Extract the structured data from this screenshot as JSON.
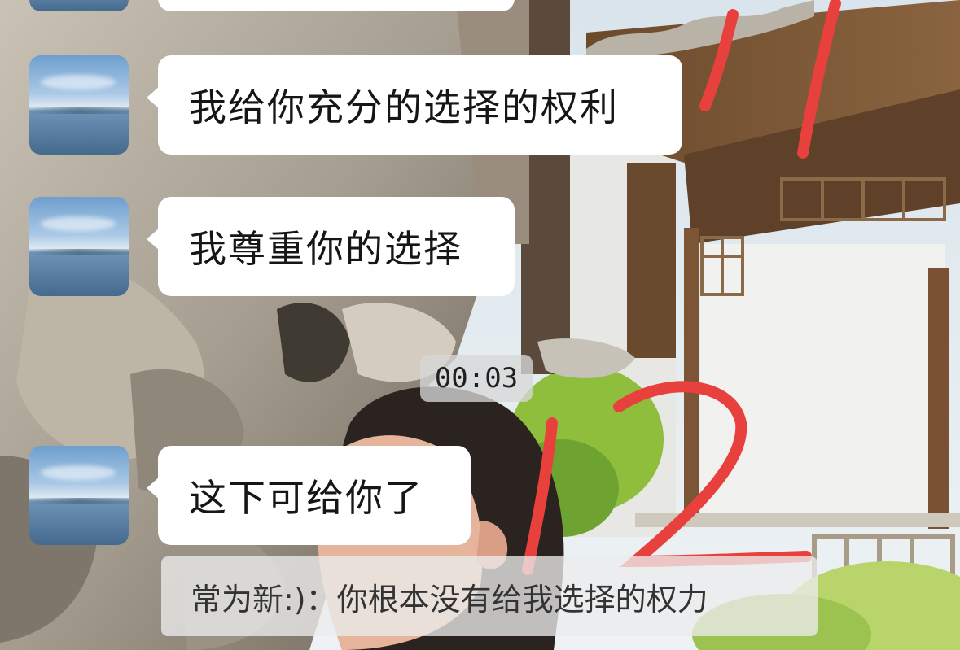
{
  "chat": {
    "messages": [
      {
        "text": "我给你充分的选择的权利"
      },
      {
        "text": "我尊重你的选择"
      },
      {
        "text": "这下可给你了"
      }
    ],
    "timestamp": "00:03",
    "quoted_reply": "常为新:)：你根本没有给我选择的权力"
  },
  "annotations": {
    "marker_color": "#e8403c",
    "marks": [
      "1",
      "2"
    ]
  }
}
